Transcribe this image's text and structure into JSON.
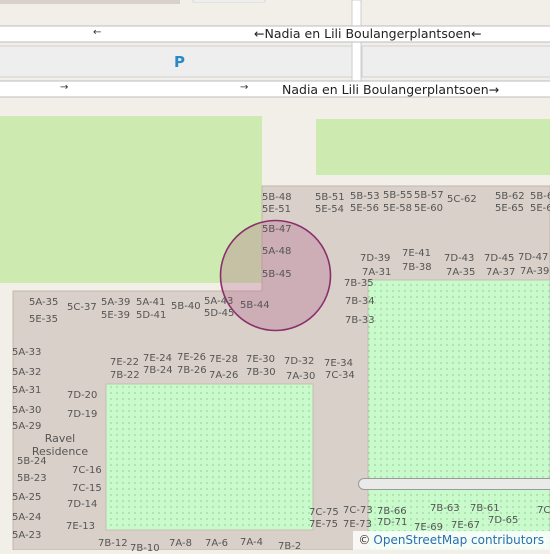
{
  "street": {
    "name": "Nadia en Lili Boulangerplantsoen",
    "arrow_left": "←",
    "arrow_right": "→"
  },
  "parking_label": "P",
  "residence_line1": "Ravel",
  "residence_line2": "Residence",
  "attribution": {
    "copy": "©",
    "text": "OpenStreetMap contributors"
  },
  "colors": {
    "background": "#f2efe9",
    "road": "#ffffff",
    "road_casing": "#bcbcbc",
    "parking_area": "#eeeeee",
    "grass": "#cdebb0",
    "building_area": "#d9d0c9",
    "garden": "#c8facc",
    "marker_fill": "#b3608c",
    "marker_stroke": "#8a2f6a",
    "parking_text": "#2b8ac6"
  },
  "housenumbers": [
    "5B-48",
    "5E-51",
    "5B-51",
    "5E-54",
    "5B-53",
    "5E-56",
    "5B-55",
    "5E-58",
    "5B-57",
    "5E-60",
    "5C-62",
    "5B-62",
    "5E-65",
    "5B-6",
    "5E-6",
    "5B-47",
    "5A-48",
    "5B-45",
    "5B-44",
    "7D-39",
    "7A-31",
    "7E-41",
    "7B-38",
    "7D-43",
    "7A-35",
    "7D-45",
    "7A-37",
    "7D-47",
    "7A-39",
    "7B-35",
    "7B-34",
    "7B-33",
    "5A-35",
    "5E-35",
    "5C-37",
    "5A-39",
    "5E-39",
    "5A-41",
    "5D-41",
    "5B-40",
    "5A-43",
    "5D-45",
    "5A-33",
    "5A-32",
    "5A-31",
    "5A-30",
    "5A-29",
    "7E-22",
    "7B-22",
    "7E-24",
    "7B-24",
    "7E-26",
    "7B-26",
    "7E-28",
    "7A-26",
    "7E-30",
    "7B-30",
    "7D-32",
    "7A-30",
    "7E-34",
    "7C-34",
    "7D-20",
    "7D-19",
    "5B-24",
    "5B-23",
    "7C-16",
    "7C-15",
    "5A-25",
    "7D-14",
    "5A-24",
    "7E-13",
    "5A-23",
    "7B-12",
    "7B-10",
    "7A-8",
    "7A-6",
    "7A-4",
    "7B-2",
    "7C-75",
    "7E-75",
    "7C-73",
    "7E-73",
    "7B-66",
    "7D-71",
    "7E-69",
    "7B-63",
    "7E-67",
    "7B-61",
    "7D-65",
    "7C"
  ]
}
